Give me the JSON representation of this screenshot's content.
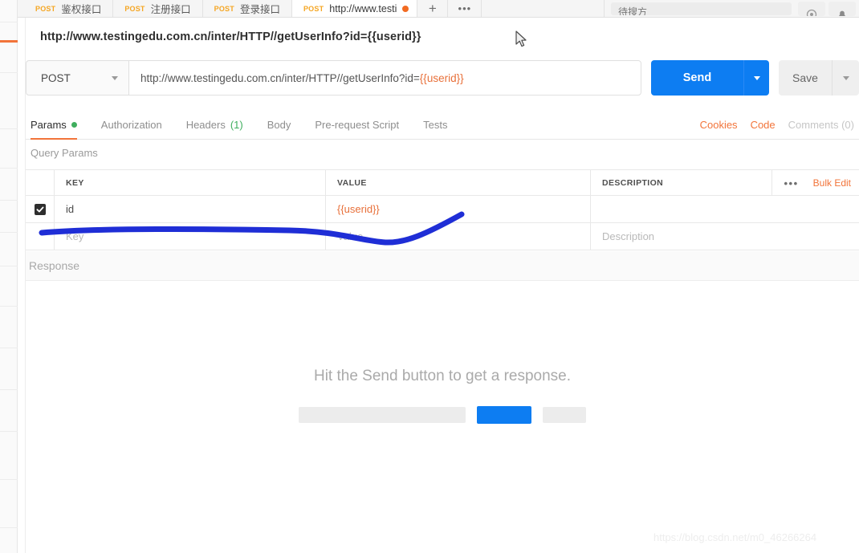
{
  "tabbar": {
    "tabs": [
      {
        "method": "POST",
        "name": "鉴权接口",
        "active": false,
        "unsaved": false
      },
      {
        "method": "POST",
        "name": "注册接口",
        "active": false,
        "unsaved": false
      },
      {
        "method": "POST",
        "name": "登录接口",
        "active": false,
        "unsaved": false
      },
      {
        "method": "POST",
        "name": "http://www.testi",
        "active": true,
        "unsaved": true
      }
    ],
    "add_label": "+",
    "more_label": "•••",
    "search_text": "待搜方"
  },
  "request": {
    "title": "http://www.testingedu.com.cn/inter/HTTP//getUserInfo?id={{userid}}",
    "method": "POST",
    "url_prefix": "http://www.testingedu.com.cn/inter/HTTP//getUserInfo?id=",
    "url_variable": "{{userid}}",
    "send_label": "Send",
    "save_label": "Save"
  },
  "section_tabs": [
    {
      "label": "Params",
      "active": true,
      "dot": true,
      "count": ""
    },
    {
      "label": "Authorization",
      "active": false,
      "dot": false,
      "count": ""
    },
    {
      "label": "Headers",
      "active": false,
      "dot": false,
      "count": "(1)"
    },
    {
      "label": "Body",
      "active": false,
      "dot": false,
      "count": ""
    },
    {
      "label": "Pre-request Script",
      "active": false,
      "dot": false,
      "count": ""
    },
    {
      "label": "Tests",
      "active": false,
      "dot": false,
      "count": ""
    }
  ],
  "section_links": {
    "cookies": "Cookies",
    "code": "Code",
    "comments": "Comments (0)"
  },
  "params": {
    "section_label": "Query Params",
    "columns": {
      "key": "KEY",
      "value": "VALUE",
      "description": "DESCRIPTION"
    },
    "bulk_edit_label": "Bulk Edit",
    "more_label": "•••",
    "rows": [
      {
        "checked": true,
        "key": "id",
        "value": "{{userid}}",
        "description": ""
      }
    ],
    "placeholder_row": {
      "key": "Key",
      "value": "Value",
      "description": "Description"
    }
  },
  "response": {
    "title": "Response",
    "empty_message": "Hit the Send button to get a response."
  },
  "watermark": "https://blog.csdn.net/m0_46266264",
  "colors": {
    "accent_orange": "#f2743a",
    "send_blue": "#0d7df2",
    "method_orange": "#f5a623",
    "green": "#3fae5e",
    "annotation_blue": "#1f2ed6"
  }
}
